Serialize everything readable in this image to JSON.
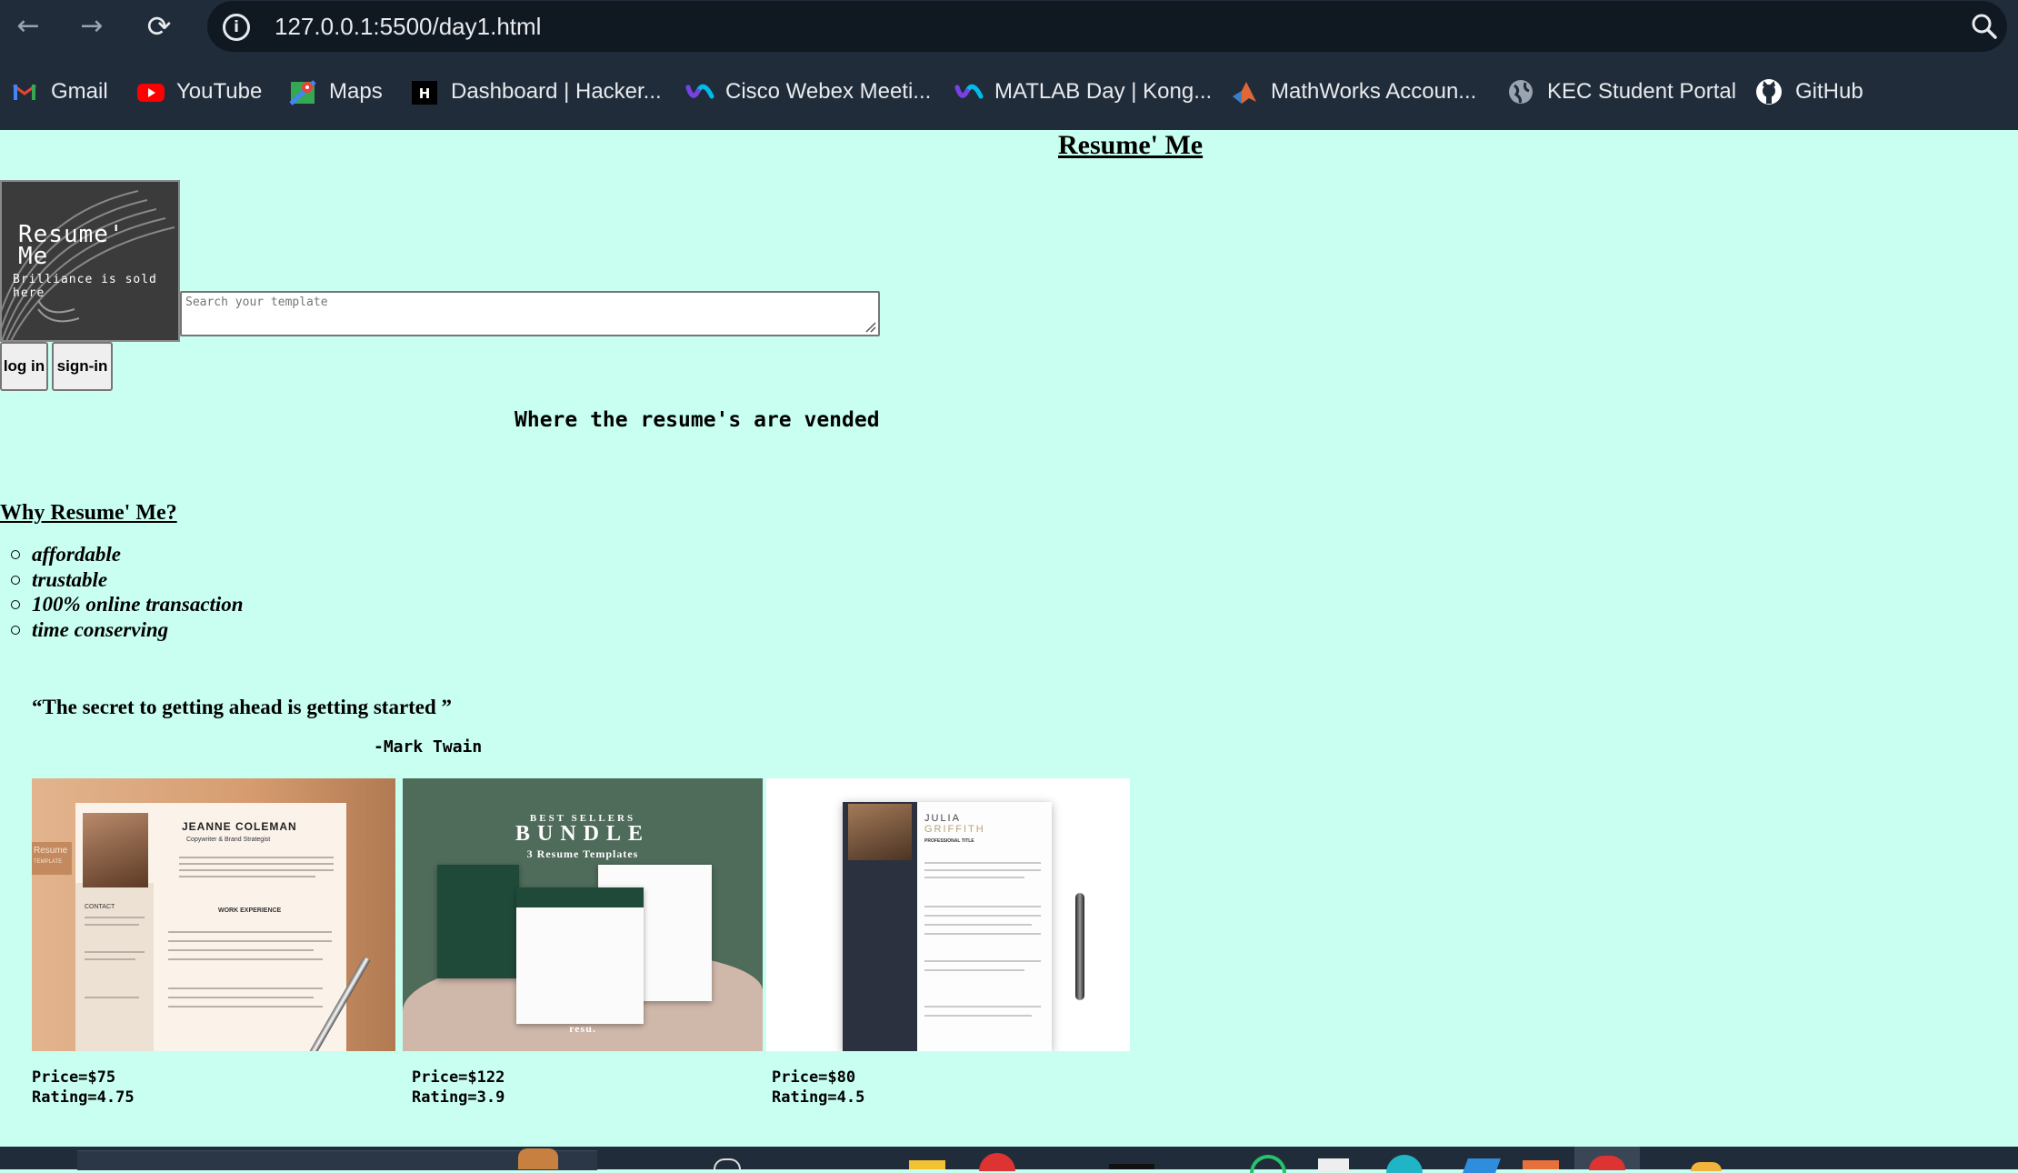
{
  "browser": {
    "url": "127.0.0.1:5500/day1.html",
    "bookmarks": [
      {
        "label": "Gmail",
        "icon": "gmail-icon"
      },
      {
        "label": "YouTube",
        "icon": "youtube-icon"
      },
      {
        "label": "Maps",
        "icon": "maps-icon"
      },
      {
        "label": "Dashboard | Hacker...",
        "icon": "hackerrank-icon"
      },
      {
        "label": "Cisco Webex Meeti...",
        "icon": "webex-icon"
      },
      {
        "label": "MATLAB Day | Kong...",
        "icon": "webex-icon"
      },
      {
        "label": "MathWorks Accoun...",
        "icon": "matlab-icon"
      },
      {
        "label": "KEC Student Portal",
        "icon": "globe-icon"
      },
      {
        "label": "GitHub",
        "icon": "github-icon"
      }
    ]
  },
  "page": {
    "title": "Resume' Me",
    "logo": {
      "line1": "Resume'",
      "line2": "Me",
      "tagline": "Brilliance is sold here"
    },
    "search_placeholder": "Search your template",
    "login_label": "log in",
    "signin_label": "sign-in",
    "tagline": "Where the resume's are vended",
    "why_heading": "Why Resume' Me?",
    "features": [
      "affordable",
      "trustable",
      "100% online transaction",
      "time conserving"
    ],
    "quote": "“The secret to getting ahead is getting started ”",
    "author": "-Mark Twain",
    "products": [
      {
        "price": "Price=$75",
        "rating": "Rating=4.75",
        "image": {
          "name": "JEANNE COLEMAN",
          "subtitle": "Copywriter & Brand Strategist",
          "side_tag": "Resume",
          "side_tag2": "TEMPLATE",
          "section": "WORK EXPERIENCE",
          "contact": "CONTACT"
        }
      },
      {
        "price": "Price=$122",
        "rating": "Rating=3.9",
        "image": {
          "line1": "BEST SELLERS",
          "line2": "BUNDLE",
          "line3": "3 Resume Templates",
          "brand": "resu."
        }
      },
      {
        "price": "Price=$80",
        "rating": "Rating=4.5",
        "image": {
          "first": "JULIA",
          "last": "GRIFFITH",
          "title": "PROFESSIONAL TITLE"
        }
      }
    ]
  },
  "colors": {
    "page_bg": "#c8fff1",
    "chrome_bg": "#202c3a",
    "omnibox_bg": "#101822"
  }
}
